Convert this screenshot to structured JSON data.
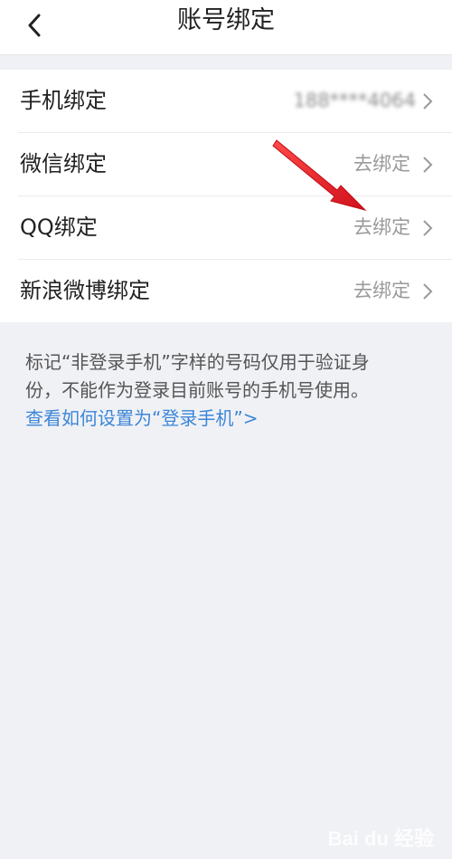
{
  "header": {
    "title": "账号绑定"
  },
  "bindings": [
    {
      "label": "手机绑定",
      "value": "188****4064"
    },
    {
      "label": "微信绑定",
      "value": "去绑定"
    },
    {
      "label": "QQ绑定",
      "value": "去绑定"
    },
    {
      "label": "新浪微博绑定",
      "value": "去绑定"
    }
  ],
  "note": {
    "line1": "标记“非登录手机”字样的号码仅用于验证身",
    "line2": "份，不能作为登录目前账号的手机号使用。",
    "link": "查看如何设置为“登录手机”>"
  },
  "watermark": "Bai du 经验",
  "colors": {
    "accent_link": "#3b86d8",
    "annotation_arrow": "#e8202a",
    "background": "#f0f1f5"
  },
  "icons": [
    "back-arrow-icon",
    "chevron-right-icon",
    "red-annotation-arrow"
  ]
}
